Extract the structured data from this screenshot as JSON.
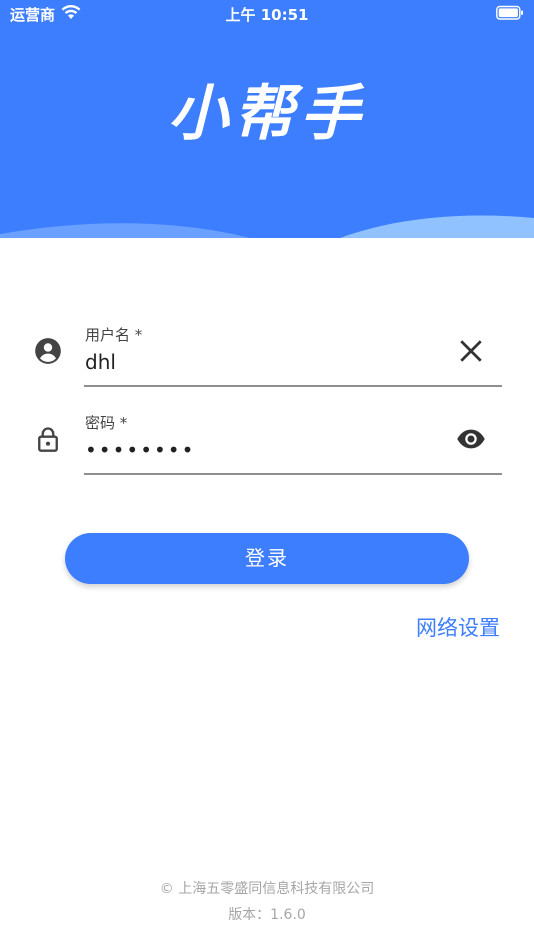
{
  "status_bar": {
    "carrier": "运营商",
    "time": "上午 10:51",
    "wifi_icon": "wifi-icon",
    "battery_icon": "battery-icon"
  },
  "header": {
    "logo_text": "小帮手",
    "background_color": "#3d7eff"
  },
  "form": {
    "username": {
      "label": "用户名 *",
      "value": "dhl",
      "icon": "account-circle-icon",
      "action_icon": "clear-icon"
    },
    "password": {
      "label": "密码 *",
      "value": "••••••••",
      "icon": "lock-icon",
      "action_icon": "eye-icon"
    }
  },
  "actions": {
    "login_label": "登录",
    "network_settings_label": "网络设置"
  },
  "footer": {
    "company": "© 上海五零盛同信息科技有限公司",
    "version": "版本：1.6.0"
  },
  "colors": {
    "accent": "#3d7eff",
    "footer_text": "#a6a6a6"
  }
}
